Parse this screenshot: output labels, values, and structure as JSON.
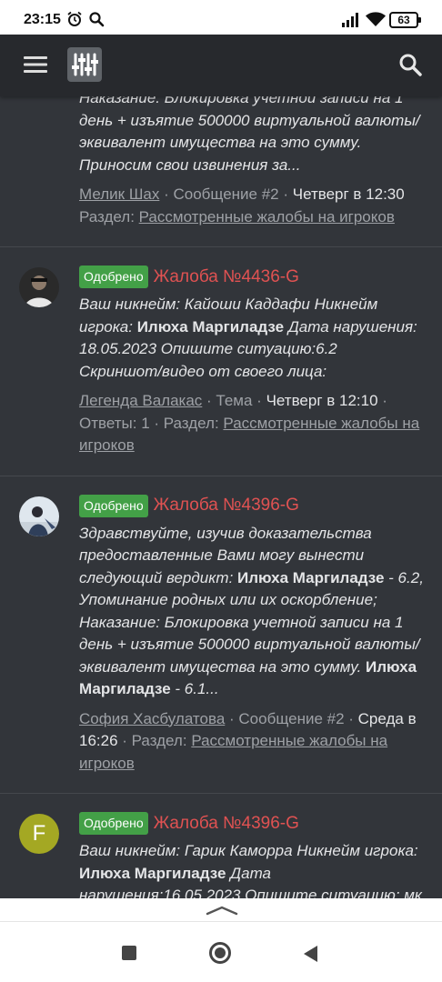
{
  "status_bar": {
    "time": "23:15",
    "battery": "63"
  },
  "header": {
    "menu_icon": "hamburger-icon",
    "logo_icon": "equalizer-logo-icon",
    "search_icon": "search-icon"
  },
  "colors": {
    "badge": "#43a047",
    "title": "#e05252",
    "background": "#32353a",
    "header": "#27292d"
  },
  "items": [
    {
      "snippet_html": "<i>Наказание: Блокировка учетной записи на 1 день + изъятие 500000 виртуальной валюты/эквивалент имущества на это сумму. Приносим свои извинения за...</i>",
      "author": "Мелик Шах",
      "type": "Сообщение #2",
      "date": "Четверг в 12:30",
      "section_label": "Раздел:",
      "section": "Рассмотренные жалобы на игроков"
    },
    {
      "badge": "Одобрено",
      "title": "Жалоба №4436-G",
      "snippet_html": "Ваш никнейм: Кайоши Каддафи Никнейм игрока: <b>Илюха Маргиладзе</b> Дата нарушения: 18.05.2023 Опишите ситуацию:6.2 Скриншот/видео от своего лица:",
      "author": "Легенда Валакас",
      "type": "Тема",
      "date": "Четверг в 12:10",
      "replies": "Ответы: 1",
      "section_label": "Раздел:",
      "section": "Рассмотренные жалобы на игроков"
    },
    {
      "badge": "Одобрено",
      "title": "Жалоба №4396-G",
      "snippet_html": "Здравствуйте, изучив доказательства предоставленные Вами могу вынести следующий вердикт: <b>Илюха Маргиладзе</b> - 6.2, Упоминание родных или их оскорбление; Наказание: Блокировка учетной записи на 1 день + изъятие 500000 виртуальной валюты/эквивалент имущества на это сумму. <b>Илюха Маргиладзе</b> - 6.1...",
      "author": "София Хасбулатова",
      "type": "Сообщение #2",
      "date": "Среда в 16:26",
      "section_label": "Раздел:",
      "section": "Рассмотренные жалобы на игроков"
    },
    {
      "badge": "Одобрено",
      "title": "Жалоба №4396-G",
      "avatar_letter": "F",
      "snippet_html": "Ваш никнейм: Гарик Каморра Никнейм игрока: <b>Илюха Маргиладзе</b> Дата нарушения:16.05.2023 Опишите ситуацию: мк"
    }
  ]
}
